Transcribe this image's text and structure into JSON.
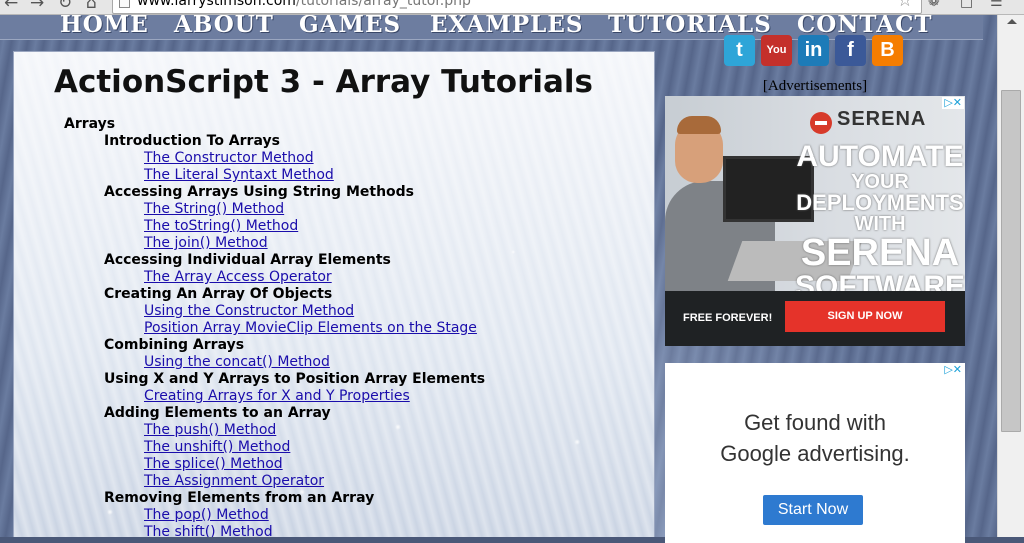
{
  "browser": {
    "url_host": "www.larrystimson.com",
    "url_path": "/tutorials/array_tutor.php"
  },
  "nav": {
    "items": [
      "HOME",
      "ABOUT",
      "GAMES",
      "EXAMPLES",
      "TUTORIALS",
      "CONTACT"
    ]
  },
  "main": {
    "title": "ActionScript 3 - Array Tutorials",
    "root": "Arrays",
    "sections": [
      {
        "label": "Introduction To Arrays",
        "links": [
          "The Constructor Method",
          "The Literal Syntaxt Method"
        ]
      },
      {
        "label": "Accessing Arrays Using String Methods",
        "links": [
          "The String() Method",
          "The toString() Method",
          "The join() Method"
        ]
      },
      {
        "label": "Accessing Individual Array Elements",
        "links": [
          "The Array Access Operator"
        ]
      },
      {
        "label": "Creating An Array Of Objects",
        "links": [
          "Using the Constructor Method",
          "Position Array MovieClip Elements on the Stage"
        ]
      },
      {
        "label": "Combining Arrays",
        "links": [
          "Using the concat() Method"
        ]
      },
      {
        "label": "Using X and Y Arrays to Position Array Elements",
        "links": [
          "Creating Arrays for X and Y Properties"
        ]
      },
      {
        "label": "Adding Elements to an Array",
        "links": [
          "The push() Method",
          "The unshift() Method",
          "The splice() Method",
          "The Assignment Operator"
        ]
      },
      {
        "label": "Removing Elements from an Array",
        "links": [
          "The pop() Method",
          "The shift() Method"
        ]
      }
    ]
  },
  "social": [
    {
      "name": "twitter-icon",
      "glyph": "t",
      "color": "#2ea5d8"
    },
    {
      "name": "youtube-icon",
      "glyph": "You",
      "color": "#c4302b"
    },
    {
      "name": "linkedin-icon",
      "glyph": "in",
      "color": "#1d7bb8"
    },
    {
      "name": "facebook-icon",
      "glyph": "f",
      "color": "#3b5998"
    },
    {
      "name": "blogger-icon",
      "glyph": "B",
      "color": "#f57d00"
    }
  ],
  "ads": {
    "label": "[Advertisements]",
    "ad1": {
      "brand": "SERENA",
      "headline": [
        "AUTOMATE",
        "YOUR",
        "DEPLOYMENTS",
        "WITH",
        "SERENA",
        "SOFTWARE"
      ],
      "free": "FREE FOREVER!",
      "cta": "SIGN UP NOW",
      "accent": "#e5332a"
    },
    "ad2": {
      "line1": "Get found with",
      "line2": "Google advertising.",
      "button": "Start Now",
      "accent": "#2e7ad0"
    }
  }
}
